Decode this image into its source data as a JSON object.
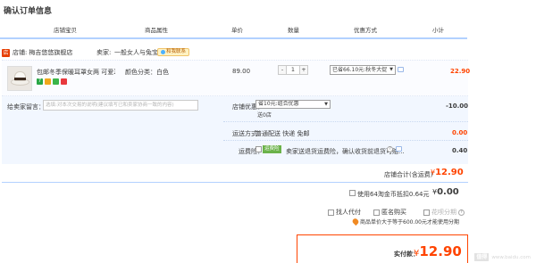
{
  "page": {
    "title": "确认订单信息"
  },
  "columns": [
    "店铺宝贝",
    "商品属性",
    "单价",
    "数量",
    "优惠方式",
    "小计"
  ],
  "store": {
    "icon_text": "店",
    "label": "店铺:",
    "name": "梅吉悠悠旗舰店",
    "seller_label": "卖家:",
    "seller_name": "一般女人与兔宝宝",
    "contact_label": "和我联系"
  },
  "item": {
    "title": "包邮冬季保暖耳罩女两 可爱耳...",
    "service_icon_text": "7",
    "attr": "颜色分类：白色",
    "price": "89.00",
    "qty": {
      "dec": "-",
      "value": "1",
      "inc": "+"
    },
    "promo_select": "已省66.10元:秋冬大促",
    "promo_arrow": "▼",
    "subtotal": "22.90"
  },
  "order": {
    "message_label": "给卖家留言：",
    "message_placeholder": "选填:对本次交易的说明(建议填写已和卖家协商一致的内容)",
    "discount_label": "店铺优惠：",
    "discount_select": "省10元:组合优惠",
    "discount_arrow": "▼",
    "discount_sub": "送0店",
    "discount_amount": "-10.00",
    "shipping_label": "运送方式：",
    "shipping_value": "普通配送 快递 免邮",
    "shipping_amount": "0.00",
    "insurance_label": "运费险：",
    "insurance_badge": "运费险",
    "insurance_text": "卖家送退货运费险，确认收货前退货可赔...",
    "insurance_q": "?",
    "insurance_amount": "0.40"
  },
  "store_total": {
    "label": "店铺合计(含运费)",
    "currency": "¥",
    "amount": "12.90"
  },
  "tmall_points": {
    "text": "使用64淘金币抵扣0.64元",
    "currency": "¥",
    "amount": "0.00"
  },
  "pay_options": {
    "proxy": "找人代付",
    "anonymous": "匿名购买",
    "installment": "花呗分期",
    "q": "?",
    "limit_text": "商品单价大于等于600.00元才能使用分期"
  },
  "pay": {
    "label": "实付款：",
    "currency": "¥",
    "amount": "12.90"
  },
  "watermark": {
    "logo": "值得",
    "text": "www.baidu.com"
  }
}
